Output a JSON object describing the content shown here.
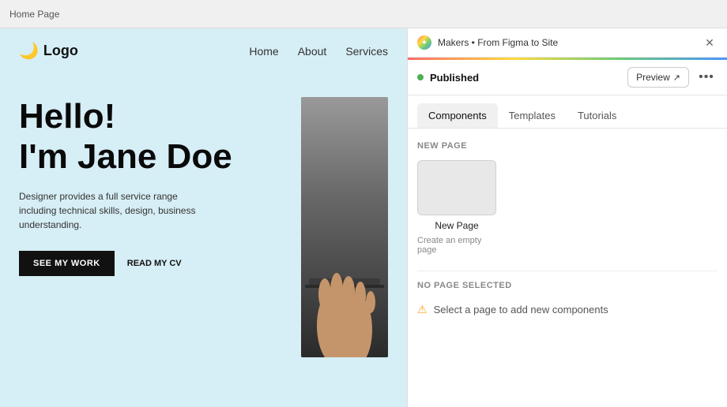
{
  "topbar": {
    "label": "Home Page"
  },
  "website": {
    "logo": "Logo",
    "logo_icon": "🌙",
    "nav": {
      "items": [
        "Home",
        "About",
        "Services"
      ]
    },
    "hero": {
      "title_line1": "Hello!",
      "title_line2": "I'm Jane Doe",
      "description": "Designer provides a full service range including technical skills, design, business understanding.",
      "btn_primary": "SEE MY WORK",
      "btn_secondary": "READ MY CV"
    }
  },
  "panel": {
    "favicon_icon": "✦",
    "title": "Makers • From Figma to Site",
    "close_icon": "✕",
    "status": {
      "dot_color": "#4caf50",
      "text": "Published"
    },
    "preview_button": "Preview",
    "preview_icon": "↗",
    "more_icon": "•••",
    "tabs": [
      {
        "id": "components",
        "label": "Components",
        "active": true
      },
      {
        "id": "templates",
        "label": "Templates",
        "active": false
      },
      {
        "id": "tutorials",
        "label": "Tutorials",
        "active": false
      }
    ],
    "content": {
      "new_page_section_label": "NEW PAGE",
      "new_page_label": "New Page",
      "new_page_sublabel": "Create an empty page",
      "no_page_section_label": "NO PAGE SELECTED",
      "no_page_message": "Select a page to add new components",
      "warning_icon": "⚠"
    }
  }
}
